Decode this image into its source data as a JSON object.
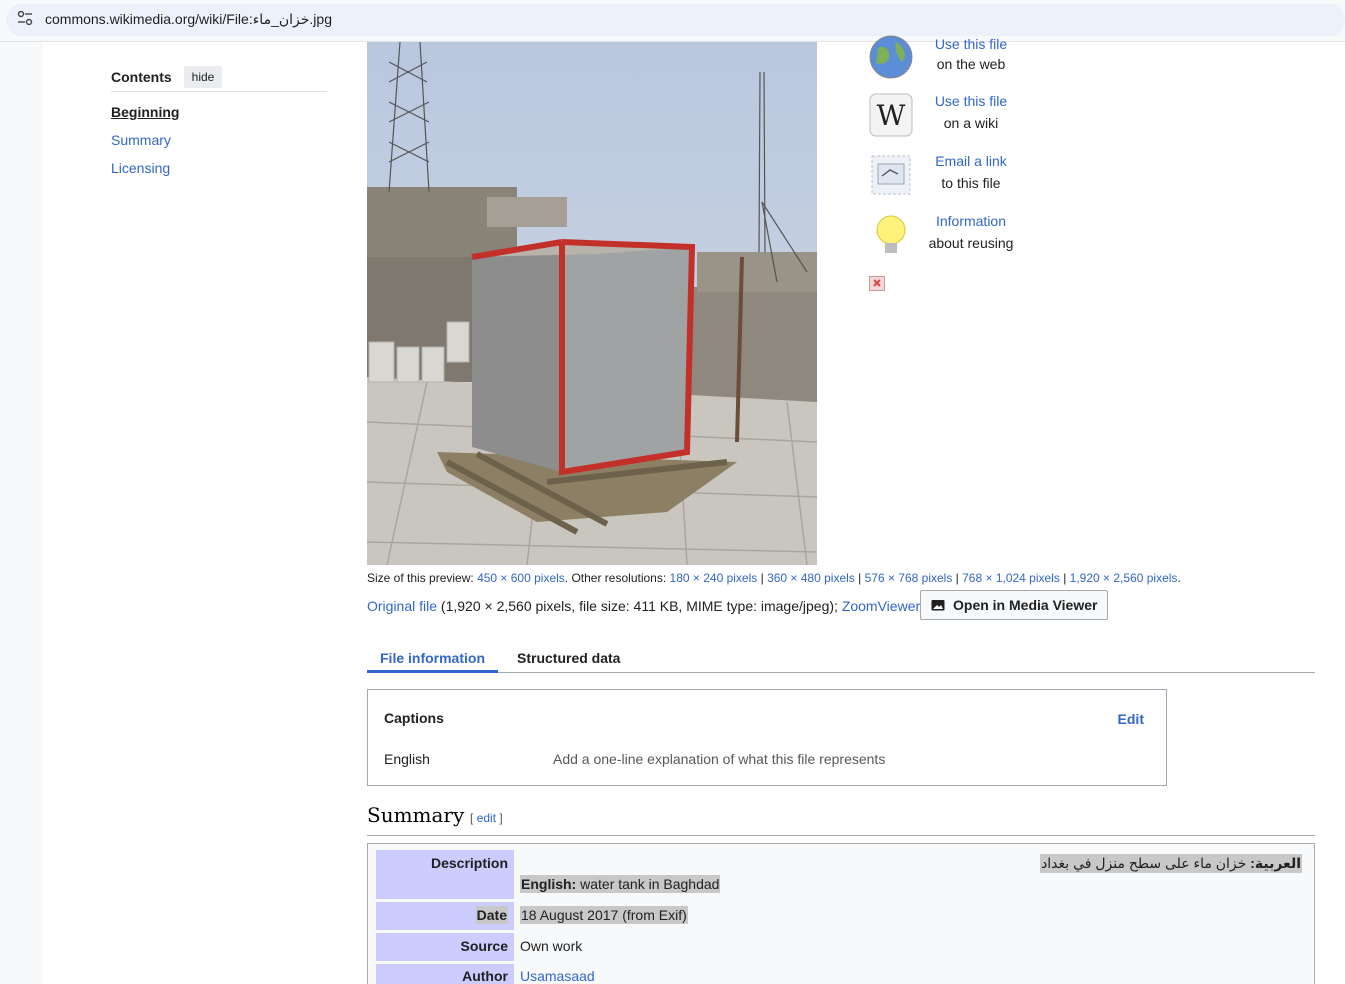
{
  "browser": {
    "url": "commons.wikimedia.org/wiki/File:خزان_ماء.jpg"
  },
  "toc": {
    "title": "Contents",
    "hide_label": "hide",
    "items": [
      {
        "label": "Beginning"
      },
      {
        "label": "Summary"
      },
      {
        "label": "Licensing"
      }
    ]
  },
  "use_panel": [
    {
      "line1": "Use this file",
      "line2": "on the web",
      "icon": "globe-icon"
    },
    {
      "line1": "Use this file",
      "line2": "on a wiki",
      "icon": "wikipedia-icon"
    },
    {
      "line1": "Email a link",
      "line2": "to this file",
      "icon": "envelope-icon"
    },
    {
      "line1": "Information",
      "line2": "about reusing",
      "icon": "lightbulb-icon"
    }
  ],
  "resolutions": {
    "preview_label": "Size of this preview:",
    "preview": "450 × 600 pixels",
    "other_label": ". Other resolutions:",
    "others": [
      "180 × 240 pixels",
      "360 × 480 pixels",
      "576 × 768 pixels",
      "768 × 1,024 pixels",
      "1,920 × 2,560 pixels"
    ]
  },
  "original": {
    "link": "Original file",
    "details": "(1,920 × 2,560 pixels, file size: 411 KB, MIME type: image/jpeg);",
    "zoom": "ZoomViewer",
    "media_viewer_button": "Open in Media Viewer"
  },
  "tabs": [
    "File information",
    "Structured data"
  ],
  "captions": {
    "heading": "Captions",
    "edit": "Edit",
    "language": "English",
    "placeholder": "Add a one-line explanation of what this file represents"
  },
  "summary": {
    "heading": "Summary",
    "edit_link": "edit",
    "bracket_open": "[",
    "bracket_close": "]",
    "rows": {
      "description_label": "Description",
      "description_ar_lang": "العربية:",
      "description_ar": " خزان ماء على سطح منزل في بغداد",
      "description_en_lang": "English:",
      "description_en": " water tank in Baghdad",
      "date_label": "Date",
      "date": "18 August 2017 (from Exif)",
      "source_label": "Source",
      "source": "Own work",
      "author_label": "Author",
      "author": "Usamasaad"
    }
  },
  "colors": {
    "link": "#3366cc",
    "infobox_label_bg": "#ccccff",
    "highlight": "#c8c8c8"
  }
}
